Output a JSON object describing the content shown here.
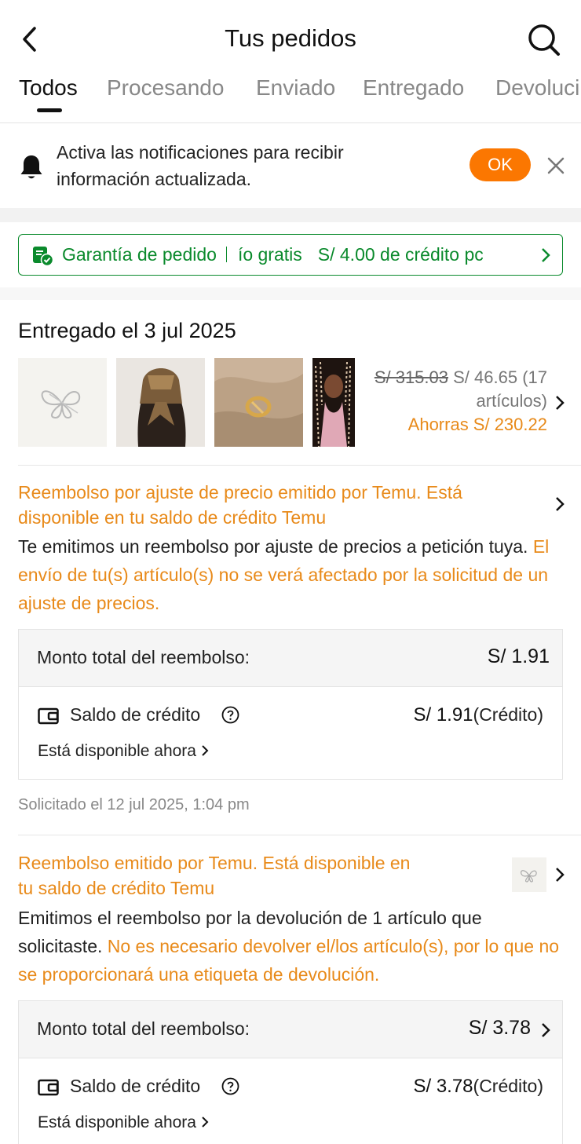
{
  "header": {
    "title": "Tus pedidos"
  },
  "tabs": [
    {
      "label": "Todos",
      "active": true
    },
    {
      "label": "Procesando"
    },
    {
      "label": "Enviado"
    },
    {
      "label": "Entregado"
    },
    {
      "label": "Devoluci"
    }
  ],
  "notification": {
    "line1": "Activa las notificaciones para recibir",
    "line2": "información actualizada.",
    "ok_label": "OK"
  },
  "guarantee": {
    "text_a": "Garantía de pedido",
    "text_b": "ío gratis",
    "text_c": "S/ 4.00 de crédito pc"
  },
  "order": {
    "title": "Entregado el 3 jul 2025",
    "price_old": "S/ 315.03",
    "price_new": "S/ 46.65 (17",
    "items_count": "artículos)",
    "savings": "Ahorras S/ 230.22",
    "thumbnails": [
      "butterfly-hair-clip",
      "silk-headscarf",
      "gold-ring",
      "braided-wig"
    ]
  },
  "refund1": {
    "title_line1": "Reembolso por ajuste de precio emitido por Temu. Está",
    "title_line2": "disponible en tu saldo de crédito Temu",
    "body_black": "Te emitimos un reembolso por ajuste de precios a petición tuya.",
    "body_orange": "El envío de tu(s) artículo(s) no se verá afectado por la solicitud de un ajuste de precios.",
    "total_label": "Monto total del reembolso:",
    "total_amount": "S/ 1.91",
    "credit_label": "Saldo de crédito",
    "credit_amount": "S/ 1.91",
    "credit_suffix": "(Crédito)",
    "available": "Está disponible ahora",
    "requested": "Solicitado el 12 jul 2025, 1:04 pm"
  },
  "refund2": {
    "title_line1": "Reembolso emitido por Temu. Está disponible en",
    "title_line2": "tu saldo de crédito Temu",
    "body_black": "Emitimos el reembolso por la devolución de 1 artículo que solicitaste.",
    "body_orange": "No es necesario devolver el/los artículo(s), por lo que no se proporcionará una etiqueta de devolución.",
    "total_label": "Monto total del reembolso:",
    "total_amount": "S/ 3.78",
    "credit_label": "Saldo de crédito",
    "credit_amount": "S/ 3.78",
    "credit_suffix": "(Crédito)",
    "available": "Está disponible ahora"
  },
  "colors": {
    "accent": "#fb7701",
    "orange_text": "#e88a1a",
    "green": "#0a8a2c"
  },
  "icons": [
    "back-arrow-icon",
    "search-icon",
    "bell-icon",
    "close-icon",
    "shield-check-icon",
    "chevron-right-icon",
    "wallet-icon",
    "help-circle-icon"
  ]
}
